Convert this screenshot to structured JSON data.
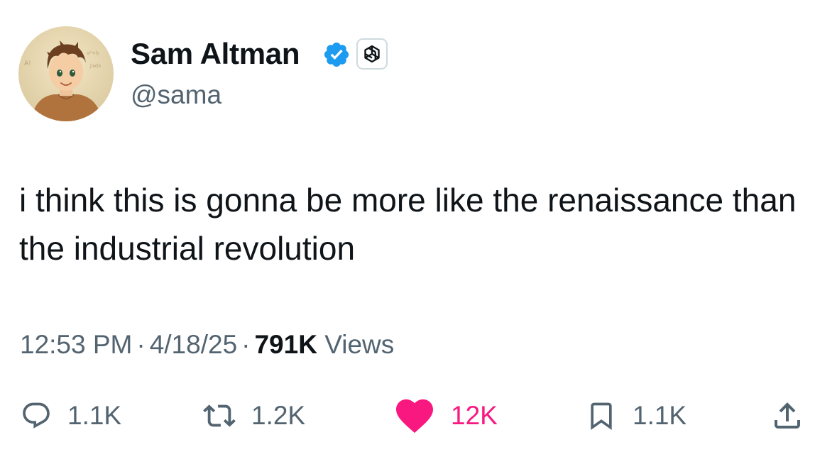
{
  "author": {
    "display_name": "Sam Altman",
    "handle": "@sama",
    "verified": true,
    "affiliate_badge": "openai-logo-icon",
    "avatar": "illustrated-avatar"
  },
  "tweet": {
    "text": "i think this is gonna be more like the renaissance than the industrial revolution",
    "time": "12:53 PM",
    "date": "4/18/25",
    "views_count": "791K",
    "views_label": "Views",
    "separator": "·"
  },
  "actions": {
    "reply": {
      "icon": "reply-icon",
      "count": "1.1K"
    },
    "retweet": {
      "icon": "retweet-icon",
      "count": "1.2K"
    },
    "like": {
      "icon": "heart-icon",
      "count": "12K",
      "active": true
    },
    "bookmark": {
      "icon": "bookmark-icon",
      "count": "1.1K"
    },
    "share": {
      "icon": "share-icon"
    }
  },
  "colors": {
    "text_primary": "#0f1419",
    "text_secondary": "#536471",
    "verified_blue": "#1d9bf0",
    "like_pink": "#f91880",
    "background": "#ffffff"
  }
}
